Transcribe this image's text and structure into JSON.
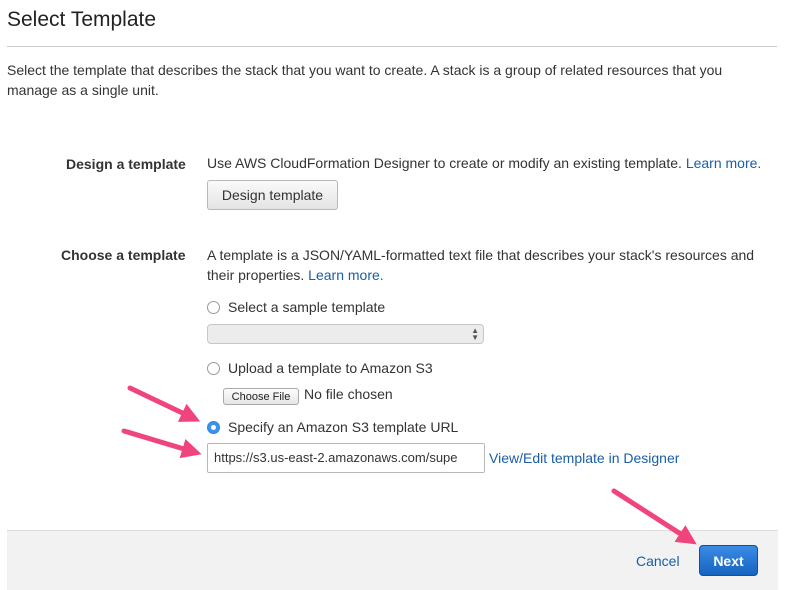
{
  "page": {
    "title": "Select Template",
    "intro": "Select the template that describes the stack that you want to create. A stack is a group of related resources that you manage as a single unit."
  },
  "design": {
    "label": "Design a template",
    "description": "Use AWS CloudFormation Designer to create or modify an existing template.",
    "learn_more": "Learn more.",
    "button_label": "Design template"
  },
  "choose": {
    "label": "Choose a template",
    "description": "A template is a JSON/YAML-formatted text file that describes your stack's resources and their properties.",
    "learn_more": "Learn more.",
    "options": {
      "sample": "Select a sample template",
      "upload": "Upload a template to Amazon S3",
      "url": "Specify an Amazon S3 template URL"
    },
    "selected_option": "url",
    "sample_select_value": "",
    "file_button_label": "Choose File",
    "file_status": "No file chosen",
    "url_value": "https://s3.us-east-2.amazonaws.com/supe",
    "view_edit_link": "View/Edit template in Designer"
  },
  "footer": {
    "cancel_label": "Cancel",
    "next_label": "Next"
  },
  "colors": {
    "link": "#1a5ea6",
    "primary_button": "#1e6fcc",
    "annotation_arrow": "#f0457c"
  }
}
